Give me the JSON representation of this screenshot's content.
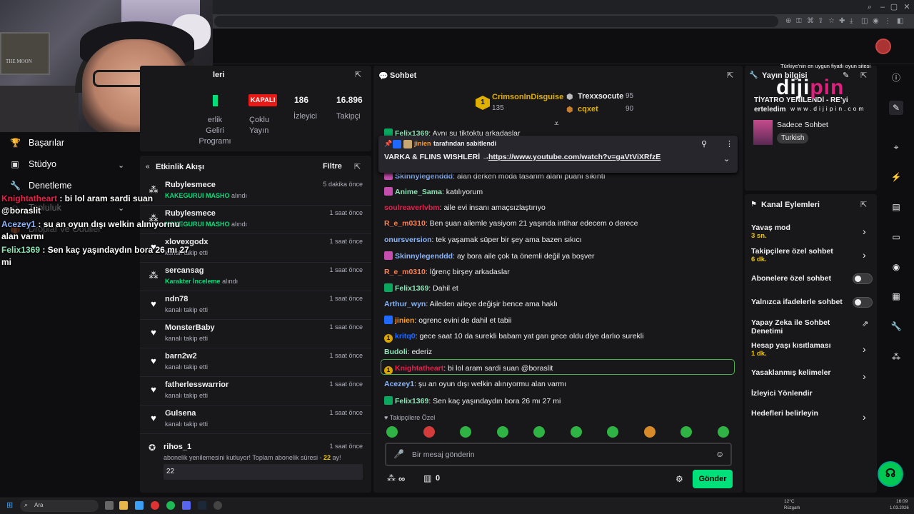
{
  "left_sidebar": {
    "items": [
      {
        "label": "Başarılar",
        "icon": "trophy-icon"
      },
      {
        "label": "Stüdyo",
        "icon": "studio-icon"
      },
      {
        "label": "Denetleme",
        "icon": "wrench-icon"
      },
      {
        "label": "Topluluk",
        "icon": "people-icon"
      },
      {
        "label": "Droplar ve Ödüller",
        "icon": "gift-icon"
      }
    ]
  },
  "overlay_chat": [
    {
      "name": "Knightatheart",
      "text": "bi lol aram sardi suan @boraslit",
      "color": "#e91e4b"
    },
    {
      "name": "Acezey1",
      "text": "su an oyun dışı welkin alınıyormu alan varmı",
      "color": "#8ab4f8"
    },
    {
      "name": "Felix1369",
      "text": "Sen kaç yaşındaydın bora 26 mı 27 mi",
      "color": "#8ee3b4"
    }
  ],
  "stats": {
    "title_partial": "leri",
    "status": "KAPALI",
    "status_label_1": "Çoklu",
    "status_label_2": "Yayın",
    "viewers": "186",
    "viewers_label": "İzleyici",
    "followers": "16.896",
    "followers_label": "Takipçi",
    "partner_1": "erlik",
    "partner_2": "Geliri",
    "partner_3": "Programı"
  },
  "activity": {
    "title": "Etkinlik Akışı",
    "filter": "Filtre",
    "items": [
      {
        "name": "Rubylesmece",
        "sub_b": "KAKEGURUI MASHO",
        "sub": "alındı",
        "time": "5 dakika önce",
        "icon": "reward-icon"
      },
      {
        "name": "Rubylesmece",
        "sub_b": "KAKEGURUI MASHO",
        "sub": "alındı",
        "time": "1 saat önce",
        "icon": "reward-icon"
      },
      {
        "name": "xlovexgodx",
        "sub_b": "",
        "sub": "kanalı takip etti",
        "time": "1 saat önce",
        "icon": "heart-icon"
      },
      {
        "name": "sercansag",
        "sub_b": "Karakter İnceleme",
        "sub": "alındı",
        "time": "1 saat önce",
        "icon": "reward-icon"
      },
      {
        "name": "ndn78",
        "sub_b": "",
        "sub": "kanalı takip etti",
        "time": "1 saat önce",
        "icon": "heart-icon"
      },
      {
        "name": "MonsterBaby",
        "sub_b": "",
        "sub": "kanalı takip etti",
        "time": "1 saat önce",
        "icon": "heart-icon"
      },
      {
        "name": "barn2w2",
        "sub_b": "",
        "sub": "kanalı takip etti",
        "time": "1 saat önce",
        "icon": "heart-icon"
      },
      {
        "name": "fatherlesswarrior",
        "sub_b": "",
        "sub": "kanalı takip etti",
        "time": "1 saat önce",
        "icon": "heart-icon"
      },
      {
        "name": "Gulsena",
        "sub_b": "",
        "sub": "kanalı takip etti",
        "time": "1 saat önce",
        "icon": "heart-icon"
      }
    ],
    "resub": {
      "name": "rihos_1",
      "time": "1 saat önce",
      "text": "abonelik yenilemesini kutluyor! Toplam abonelik süresi -",
      "months": "22",
      "unit": "ay!",
      "message": "22"
    }
  },
  "chat": {
    "title": "Sohbet",
    "leaders": [
      {
        "name": "CrimsonInDisguise",
        "score": "135",
        "rank": "1"
      },
      {
        "name": "Trexxsocute",
        "score": "95"
      },
      {
        "name": "cqxet",
        "score": "90"
      }
    ],
    "pinned": {
      "by_name": "jinien",
      "by_text": "tarafından sabitlendi",
      "title": "VARKA & FLINS WISHLERİ →",
      "link": "https://www.youtube.com/watch?v=gaVtViXRfzE"
    },
    "messages": [
      {
        "name": "Felix1369",
        "text": "Aynı su tiktoktu arkadaşlar",
        "color": "#8ee3b4",
        "badge": "b-green"
      },
      {
        "name": "Skinnylegenddd",
        "text": "alan derken moda tasarım alanı puanı sıkıntı",
        "color": "#8ab4f8",
        "badge": "b-pink"
      },
      {
        "name": "Anime_Sama",
        "text": "katılıyorum",
        "color": "#8ee3b4",
        "badge": "b-pink"
      },
      {
        "name": "soulreaverlvbm",
        "text": "aile evi insanı amaçsızlaştırıyo",
        "color": "#e91e4b",
        "badge": ""
      },
      {
        "name": "R_e_m0310",
        "text": "Ben şuan ailemle yasiyom 21 yaşında intihar edecem o derece",
        "color": "#ff7f50",
        "badge": ""
      },
      {
        "name": "onursversion",
        "text": "tek yaşamak süper bir şey ama bazen sıkıcı",
        "color": "#8ab4f8",
        "badge": ""
      },
      {
        "name": "Skinnylegenddd",
        "text": "ay bora aile çok ta önemli değil ya boşver",
        "color": "#8ab4f8",
        "badge": "b-pink"
      },
      {
        "name": "R_e_m0310",
        "text": "İğrenç birşey arkadaslar",
        "color": "#ff7f50",
        "badge": ""
      },
      {
        "name": "Felix1369",
        "text": "Dahil et",
        "color": "#8ee3b4",
        "badge": "b-green"
      },
      {
        "name": "Arthur_wyn",
        "text": "Aileden aileye değişir bence ama haklı",
        "color": "#8ab4f8",
        "badge": ""
      },
      {
        "name": "jinien",
        "text": "ogrenc evini de dahil et tabii",
        "color": "#ff9a1f",
        "badge": "b-blue"
      },
      {
        "name": "kritq0",
        "text": "gece saat 10 da surekli babam yat garı gece oldu diye darlıo surekli",
        "color": "#1f69ff",
        "badge": "b-gold"
      },
      {
        "name": "Budoli",
        "text": "ederiz",
        "color": "#8ee3b4",
        "badge": ""
      },
      {
        "name": "Knightatheart",
        "text": "bi lol aram sardi suan @boraslit",
        "color": "#e91e4b",
        "badge": "b-gold"
      },
      {
        "name": "Acezey1",
        "text": "şu an oyun dışı welkin alınıyormu alan varmı",
        "color": "#8ab4f8",
        "badge": ""
      },
      {
        "name": "Felix1369",
        "text": "Sen kaç yaşındaydın bora 26 mı 27 mi",
        "color": "#8ee3b4",
        "badge": "b-green"
      }
    ],
    "followers_only": "Takipçilere Özel",
    "input_placeholder": "Bir mesaj gönderin",
    "points": "∞",
    "drops": "0",
    "send": "Gönder"
  },
  "stream_info": {
    "title": "Yayın bilgisi",
    "stream_title": "TİYATRO YENİLENDİ - RE'yi erteledim",
    "category": "Sadece Sohbet",
    "tag": "Turkish"
  },
  "dijipin": {
    "top": "Türkiye'nin en uygun fiyatlı oyun sitesi",
    "logo_a": "diji",
    "logo_b": "pin",
    "url": "www.dijipin.com"
  },
  "channel_actions": {
    "title": "Kanal Eylemleri",
    "items": [
      {
        "label": "Yavaş mod",
        "sub": "3 sn.",
        "ctrl": "chevron"
      },
      {
        "label": "Takipçilere özel sohbet",
        "sub": "6 dk.",
        "ctrl": "chevron"
      },
      {
        "label": "Abonelere özel sohbet",
        "sub": "",
        "ctrl": "toggle"
      },
      {
        "label": "Yalnızca ifadelerle sohbet",
        "sub": "",
        "ctrl": "toggle"
      },
      {
        "label": "Yapay Zeka ile Sohbet Denetimi",
        "sub": "",
        "ctrl": "external"
      },
      {
        "label": "Hesap yaşı kısıtlaması",
        "sub": "1 dk.",
        "ctrl": "chevron"
      },
      {
        "label": "Yasaklanmış kelimeler",
        "sub": "",
        "ctrl": "chevron"
      },
      {
        "label": "İzleyici Yönlendir",
        "sub": "",
        "ctrl": "none"
      },
      {
        "label": "Hedefleri belirleyin",
        "sub": "",
        "ctrl": "chevron"
      }
    ]
  },
  "webcam": {
    "poster_text": "THE MOON"
  },
  "taskbar": {
    "search": "Ara",
    "weather_temp": "12°C",
    "weather_desc": "Rüzgarlı",
    "time": "16:09",
    "date": "1.03.2026"
  }
}
